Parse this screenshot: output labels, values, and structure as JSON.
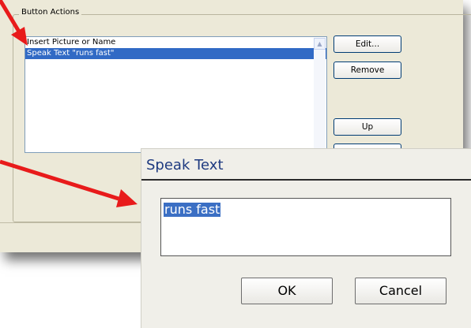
{
  "back_window": {
    "group_label": "Button Actions",
    "list_items": [
      "Insert Picture or Name",
      "Speak Text \"runs fast\""
    ],
    "selected_index": 1,
    "buttons": {
      "edit": "Edit...",
      "remove": "Remove",
      "up": "Up"
    }
  },
  "dialog": {
    "title": "Speak Text",
    "input_value": "runs fast",
    "ok_label": "OK",
    "cancel_label": "Cancel"
  },
  "colors": {
    "selection": "#316ac5",
    "arrow": "#e81b1b",
    "title_text": "#1e3a80"
  },
  "icons": {
    "scroll_up": "chevron-up-icon",
    "annotation": "red-arrow-icon"
  }
}
